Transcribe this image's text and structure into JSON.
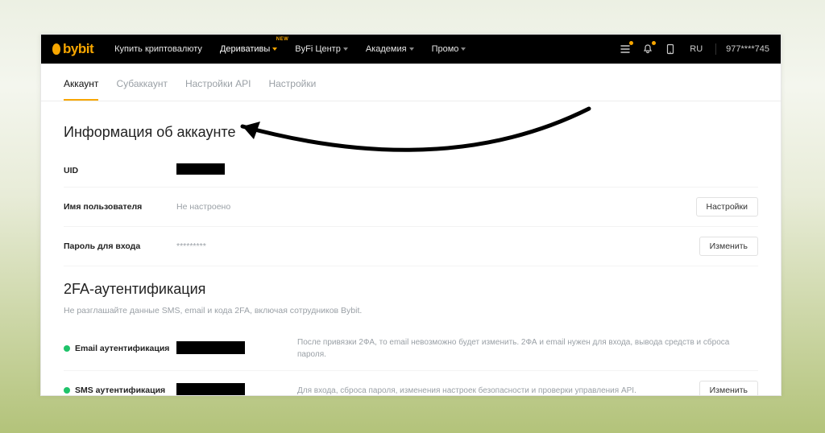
{
  "brand": "bybit",
  "nav": {
    "items": [
      {
        "label": "Купить криптовалюту",
        "dropdown": false
      },
      {
        "label": "Деривативы",
        "dropdown": true,
        "highlight": true,
        "badge": "NEW"
      },
      {
        "label": "ByFi Центр",
        "dropdown": true
      },
      {
        "label": "Академия",
        "dropdown": true
      },
      {
        "label": "Промо",
        "dropdown": true
      }
    ],
    "lang": "RU",
    "masked_id": "977****745"
  },
  "tabs": [
    {
      "label": "Аккаунт",
      "active": true
    },
    {
      "label": "Субаккаунт",
      "active": false
    },
    {
      "label": "Настройки API",
      "active": false
    },
    {
      "label": "Настройки",
      "active": false
    }
  ],
  "account_info": {
    "title": "Информация об аккаунте",
    "rows": {
      "uid": {
        "label": "UID",
        "value_redacted": true
      },
      "username": {
        "label": "Имя пользователя",
        "value": "Не настроено",
        "action": "Настройки"
      },
      "password": {
        "label": "Пароль для входа",
        "value": "*********",
        "action": "Изменить"
      }
    }
  },
  "twofa": {
    "title": "2FA-аутентификация",
    "subtitle": "Не разглашайте данные SMS, email и кода 2FA, включая сотрудников Bybit.",
    "rows": {
      "email": {
        "label": "Email аутентификация",
        "value_redacted": true,
        "desc": "После привязки 2ФА, то email невозможно будет изменить. 2ФА и email нужен для входа, вывода средств и сброса пароля."
      },
      "sms": {
        "label": "SMS аутентификация",
        "value_redacted": true,
        "desc": "Для входа, сброса пароля, изменения настроек безопасности и проверки управления API.",
        "action": "Изменить"
      }
    }
  }
}
